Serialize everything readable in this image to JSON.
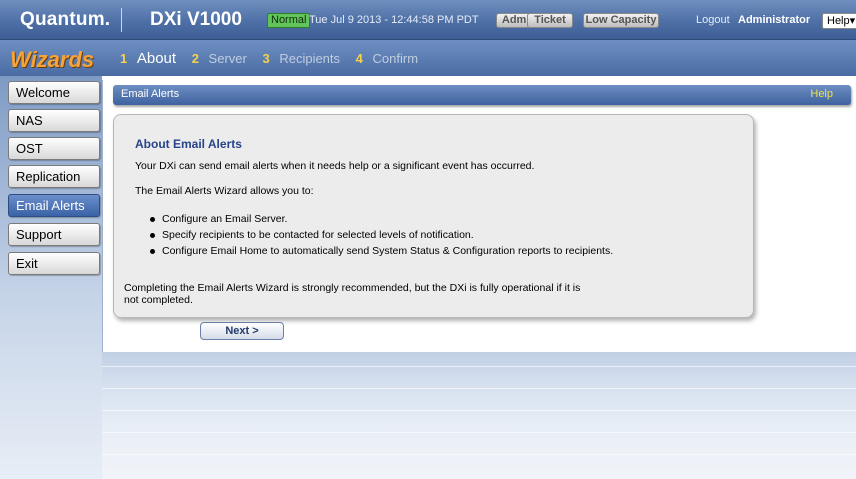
{
  "header": {
    "logo": "Quantum.",
    "product": "DXi V1000",
    "status": "Normal",
    "datetime": "Tue Jul 9 2013 - 12:44:58 PM PDT",
    "buttons": [
      "Admin",
      "Ticket",
      "Low Capacity"
    ],
    "logout": "Logout",
    "user": "Administrator",
    "help": "Help"
  },
  "wizard": {
    "title": "Wizards",
    "steps": [
      {
        "num": "1",
        "label": "About"
      },
      {
        "num": "2",
        "label": "Server"
      },
      {
        "num": "3",
        "label": "Recipients"
      },
      {
        "num": "4",
        "label": "Confirm"
      }
    ]
  },
  "sidebar": {
    "items": [
      "Welcome",
      "NAS",
      "OST",
      "Replication",
      "Email Alerts",
      "Support",
      "Exit"
    ],
    "active": "Email Alerts"
  },
  "section": {
    "title": "Email Alerts",
    "help": "Help"
  },
  "card": {
    "title": "About Email Alerts",
    "intro": "Your DXi can send email alerts when it needs help or a significant event has occurred.",
    "allows": "The Email Alerts Wizard allows you to:",
    "bullets": [
      "Configure an Email Server.",
      "Specify recipients to be contacted for selected levels of notification.",
      "Configure Email Home to automatically send System Status & Configuration reports to recipients."
    ],
    "footer": "Completing the Email Alerts Wizard is strongly recommended, but the DXi is fully operational if it is not completed."
  },
  "actions": {
    "next": "Next >"
  },
  "colors": {
    "header_blue": "#4f70a6",
    "wizard_orange": "#f6a33a",
    "status_green": "#62c45a",
    "title_blue": "#27438a",
    "help_yellow": "#f2e14a"
  }
}
